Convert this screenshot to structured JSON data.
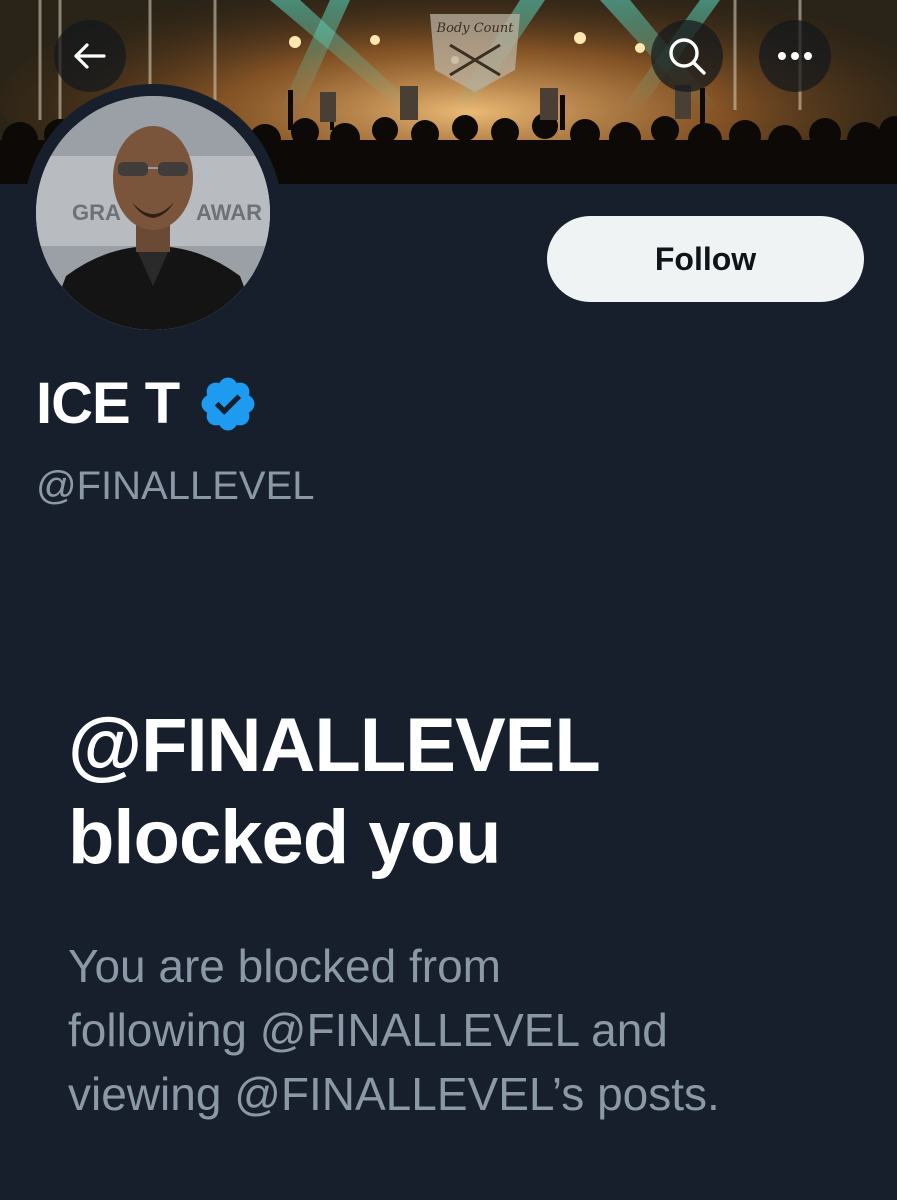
{
  "banner": {
    "sign_text": "Body Count"
  },
  "header": {
    "back_icon": "arrow-left-icon",
    "search_icon": "search-icon",
    "more_icon": "more-horizontal-icon"
  },
  "profile": {
    "avatar_text_left": "GRA",
    "avatar_text_right": "AWAR",
    "display_name": "ICE T",
    "verified_icon": "verified-badge-icon",
    "verified_color": "#1d9bf0",
    "handle": "@FINALLEVEL",
    "follow_label": "Follow"
  },
  "blocked": {
    "title_line1": "@FINALLEVEL",
    "title_line2": "blocked you",
    "desc_line1": "You are blocked from",
    "desc_line2": "following @FINALLEVEL and",
    "desc_line3": "viewing @FINALLEVEL’s posts."
  },
  "colors": {
    "background": "#161f2b",
    "primary_text": "#ffffff",
    "secondary_text": "#8b98a5",
    "follow_bg": "#eff3f4",
    "follow_text": "#0f1419"
  }
}
